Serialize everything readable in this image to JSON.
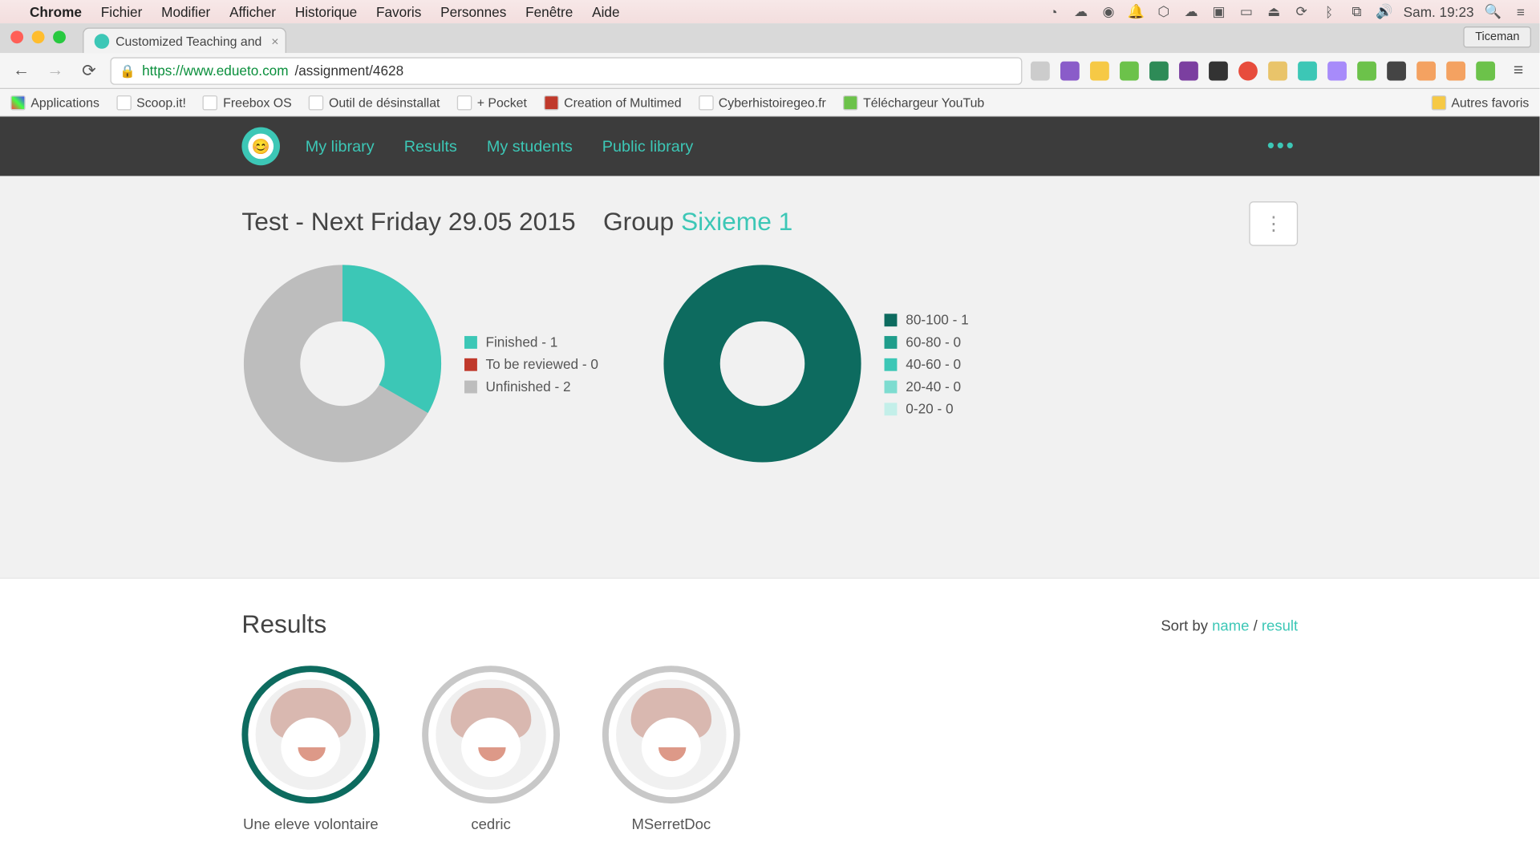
{
  "mac_menu": {
    "app": "Chrome",
    "items": [
      "Fichier",
      "Modifier",
      "Afficher",
      "Historique",
      "Favoris",
      "Personnes",
      "Fenêtre",
      "Aide"
    ],
    "clock": "Sam. 19:23"
  },
  "browser": {
    "tab_title": "Customized Teaching and",
    "user_button": "Ticeman",
    "url_host": "https://www.edueto.com",
    "url_path": "/assignment/4628",
    "bookmarks": [
      "Applications",
      "Scoop.it!",
      "Freebox OS",
      "Outil de désinstallat",
      "+ Pocket",
      "Creation of Multimed",
      "Cyberhistoiregeo.fr",
      "Téléchargeur YouTub"
    ],
    "other_bookmarks": "Autres favoris"
  },
  "app_nav": {
    "items": [
      "My library",
      "Results",
      "My students",
      "Public library"
    ]
  },
  "header": {
    "title": "Test - Next Friday 29.05 2015",
    "group_label": "Group",
    "group_name": "Sixieme 1"
  },
  "chart_data": [
    {
      "type": "pie",
      "title": "",
      "series": [
        {
          "name": "Finished",
          "value": 1,
          "color": "#3cc7b6"
        },
        {
          "name": "To be reviewed",
          "value": 0,
          "color": "#c0392b"
        },
        {
          "name": "Unfinished",
          "value": 2,
          "color": "#bdbdbd"
        }
      ],
      "legend_labels": [
        "Finished - 1",
        "To be reviewed - 0",
        "Unfinished - 2"
      ]
    },
    {
      "type": "pie",
      "title": "",
      "series": [
        {
          "name": "80-100",
          "value": 1,
          "color": "#0d6b5f"
        },
        {
          "name": "60-80",
          "value": 0,
          "color": "#1f9d8b"
        },
        {
          "name": "40-60",
          "value": 0,
          "color": "#3cc7b6"
        },
        {
          "name": "20-40",
          "value": 0,
          "color": "#7ddcd0"
        },
        {
          "name": "0-20",
          "value": 0,
          "color": "#c3efe9"
        }
      ],
      "legend_labels": [
        "80-100 - 1",
        "60-80 - 0",
        "40-60 - 0",
        "20-40 - 0",
        "0-20 - 0"
      ]
    }
  ],
  "results": {
    "heading": "Results",
    "sort_label": "Sort by ",
    "sort_name": "name",
    "sort_sep": " / ",
    "sort_result": "result",
    "students": [
      {
        "name": "Une eleve volontaire",
        "finished": true
      },
      {
        "name": "cedric",
        "finished": false
      },
      {
        "name": "MSerretDoc",
        "finished": false
      }
    ]
  }
}
